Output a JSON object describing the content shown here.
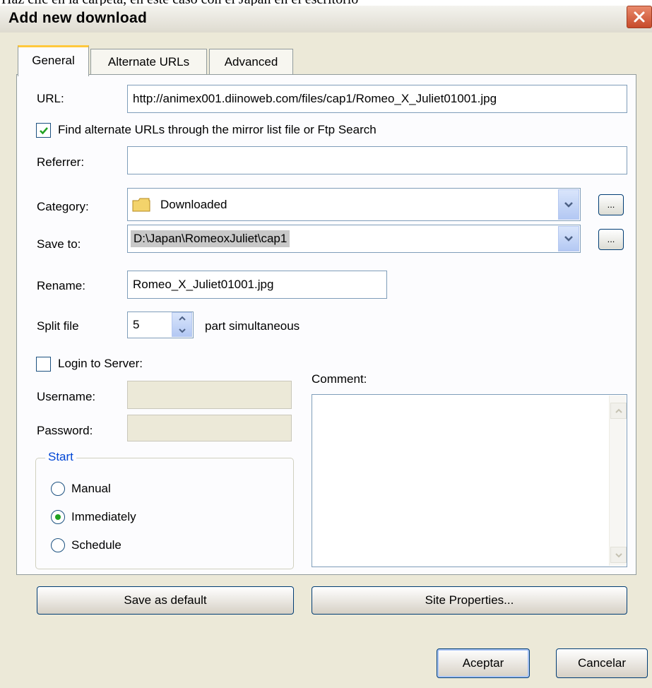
{
  "window": {
    "title": "Add new download",
    "partial_text": "Haz clic en la carpeta, en este caso con el Japan en el escritorio"
  },
  "tabs": [
    {
      "label": "General",
      "active": true
    },
    {
      "label": "Alternate URLs",
      "active": false
    },
    {
      "label": "Advanced",
      "active": false
    }
  ],
  "url": {
    "label": "URL:",
    "value": "http://animex001.diinoweb.com/files/cap1/Romeo_X_Juliet01001.jpg"
  },
  "find_alternate": {
    "label": "Find alternate URLs through the mirror list file or Ftp Search",
    "checked": true
  },
  "referrer": {
    "label": "Referrer:",
    "value": ""
  },
  "category": {
    "label": "Category:",
    "value": "Downloaded",
    "icon": "folder-icon",
    "browse_label": "..."
  },
  "save_to": {
    "label": "Save to:",
    "value": "D:\\Japan\\RomeoxJuliet\\cap1",
    "browse_label": "..."
  },
  "rename": {
    "label": "Rename:",
    "value": "Romeo_X_Juliet01001.jpg"
  },
  "split": {
    "label": "Split file",
    "value": "5",
    "suffix": "part simultaneous"
  },
  "login": {
    "label": "Login to Server:",
    "checked": false,
    "username_label": "Username:",
    "password_label": "Password:"
  },
  "comment": {
    "label": "Comment:",
    "value": ""
  },
  "start": {
    "title": "Start",
    "options": [
      {
        "label": "Manual",
        "selected": false
      },
      {
        "label": "Immediately",
        "selected": true
      },
      {
        "label": "Schedule",
        "selected": false
      }
    ]
  },
  "buttons": {
    "save_default": "Save as default",
    "site_properties": "Site Properties...",
    "ok": "Aceptar",
    "cancel": "Cancelar"
  },
  "colors": {
    "accent": "#0046d5",
    "tab_highlight": "#ffc83c",
    "radio_dot": "#21a121",
    "close": "#c74a2a"
  }
}
